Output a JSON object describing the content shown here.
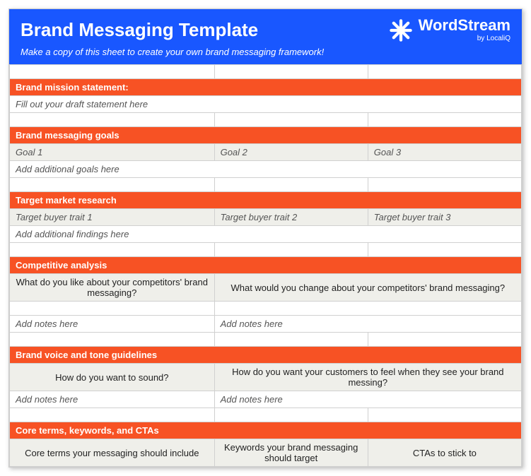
{
  "header": {
    "title": "Brand Messaging Template",
    "subtitle": "Make a copy of this sheet to create your own brand messaging framework!",
    "logo_main": "WordStream",
    "logo_sub": "by LocaliQ"
  },
  "sections": {
    "mission": {
      "heading": "Brand mission statement:",
      "placeholder": "Fill out your draft statement here"
    },
    "goals": {
      "heading": "Brand messaging goals",
      "col1": "Goal 1",
      "col2": "Goal 2",
      "col3": "Goal 3",
      "add": "Add additional goals here"
    },
    "research": {
      "heading": "Target market research",
      "col1": "Target buyer trait 1",
      "col2": "Target buyer trait 2",
      "col3": "Target buyer trait 3",
      "add": "Add additional findings here"
    },
    "competitive": {
      "heading": "Competitive analysis",
      "q1": "What do you like about your competitors' brand messaging?",
      "q2": "What would you change about your competitors' brand messaging?",
      "note1": "Add notes here",
      "note2": "Add notes here"
    },
    "voice": {
      "heading": "Brand voice and tone guidelines",
      "q1": "How do you want to sound?",
      "q2": "How do you want your customers to feel when they see your brand messing?",
      "note1": "Add notes here",
      "note2": "Add notes here"
    },
    "core": {
      "heading": "Core terms, keywords, and CTAs",
      "col1": "Core terms your messaging should include",
      "col2": "Keywords your brand messaging should target",
      "col3": "CTAs to stick to"
    }
  }
}
